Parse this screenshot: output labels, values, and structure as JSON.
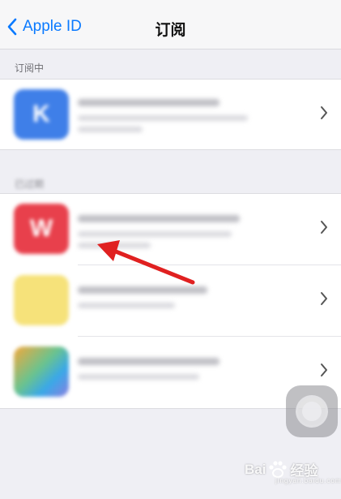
{
  "nav": {
    "back_label": "Apple ID",
    "title": "订阅"
  },
  "sections": {
    "active_header": "订阅中",
    "expired_header": "已过期"
  },
  "icons": {
    "back": "chevron-left-icon",
    "row": "chevron-right-icon",
    "assistive": "assistive-touch-icon"
  },
  "apps": {
    "active": [
      {
        "glyph": "K",
        "color": "#3f7fe8"
      }
    ],
    "expired": [
      {
        "glyph": "W",
        "color": "#e8404c"
      },
      {
        "glyph": "",
        "color": "#f6e27a"
      },
      {
        "glyph": "",
        "color": "#6ac38f"
      }
    ]
  },
  "watermark": {
    "brand_a": "Bai",
    "brand_b": "经验",
    "sub": "jingyan.baidu.com"
  },
  "colors": {
    "accent": "#0a7aff",
    "annotation_arrow": "#e02020"
  }
}
